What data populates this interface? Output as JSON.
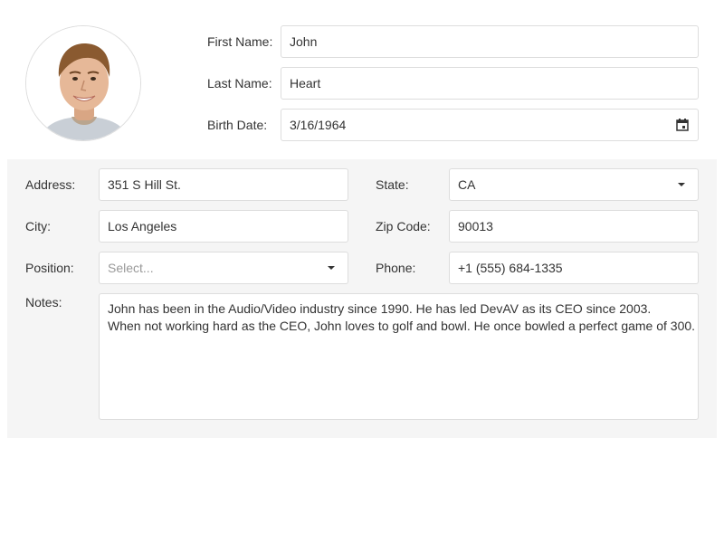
{
  "header": {
    "avatar_icon": "employee-photo",
    "first_name": {
      "label": "First Name:",
      "value": "John"
    },
    "last_name": {
      "label": "Last Name:",
      "value": "Heart"
    },
    "birth_date": {
      "label": "Birth Date:",
      "value": "3/16/1964",
      "icon": "calendar-icon"
    }
  },
  "details": {
    "address": {
      "label": "Address:",
      "value": "351 S Hill St."
    },
    "state": {
      "label": "State:",
      "value": "CA"
    },
    "city": {
      "label": "City:",
      "value": "Los Angeles"
    },
    "zip": {
      "label": "Zip Code:",
      "value": "90013"
    },
    "position": {
      "label": "Position:",
      "placeholder": "Select..."
    },
    "phone": {
      "label": "Phone:",
      "value": "+1 (555) 684-1335"
    },
    "notes": {
      "label": "Notes:",
      "line1": "John has been in the Audio/Video industry since 1990. He has led DevAV as its CEO since 2003.",
      "line2": "When not working hard as the CEO, John loves to golf and bowl. He once bowled a perfect game of 300."
    }
  },
  "colors": {
    "panel_bg": "#f5f5f5",
    "border": "#dddddd",
    "text": "#333333",
    "placeholder": "#999999"
  }
}
